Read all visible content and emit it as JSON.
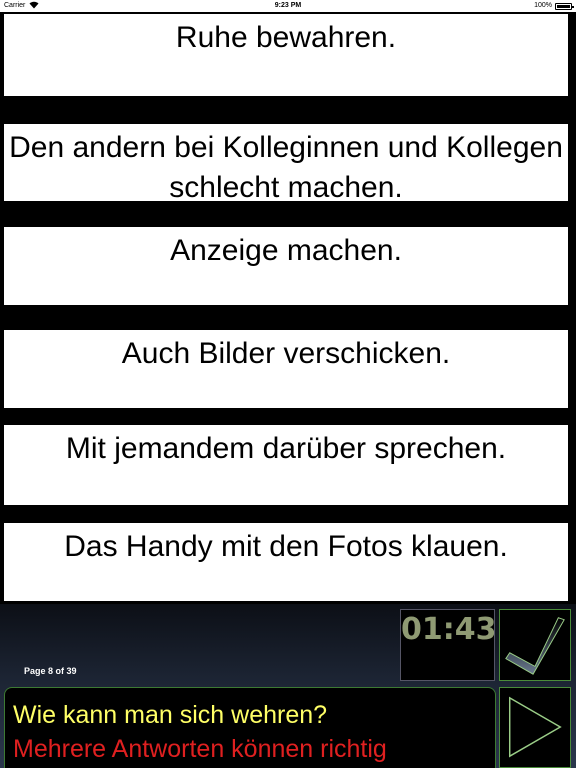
{
  "status_bar": {
    "carrier": "Carrier",
    "time": "9:23 PM",
    "battery": "100%"
  },
  "answers": [
    "Ruhe bewahren.",
    "Den andern bei Kolleginnen und Kollegen schlecht machen.",
    "Anzeige machen.",
    "Auch Bilder verschicken.",
    "Mit jemandem darüber sprechen.",
    "Das Handy mit den Fotos klauen."
  ],
  "footer": {
    "page_label": "Page 8 of 39",
    "timer": "01:43",
    "question": "Wie kann man sich wehren?",
    "hint": "Mehrere Antworten können richtig"
  },
  "icons": {
    "check": "checkmark-icon",
    "next": "play-triangle-icon"
  },
  "colors": {
    "question": "#ffff66",
    "hint": "#e02020",
    "timer": "#8f9a73",
    "button_border": "#4a8c3a"
  }
}
